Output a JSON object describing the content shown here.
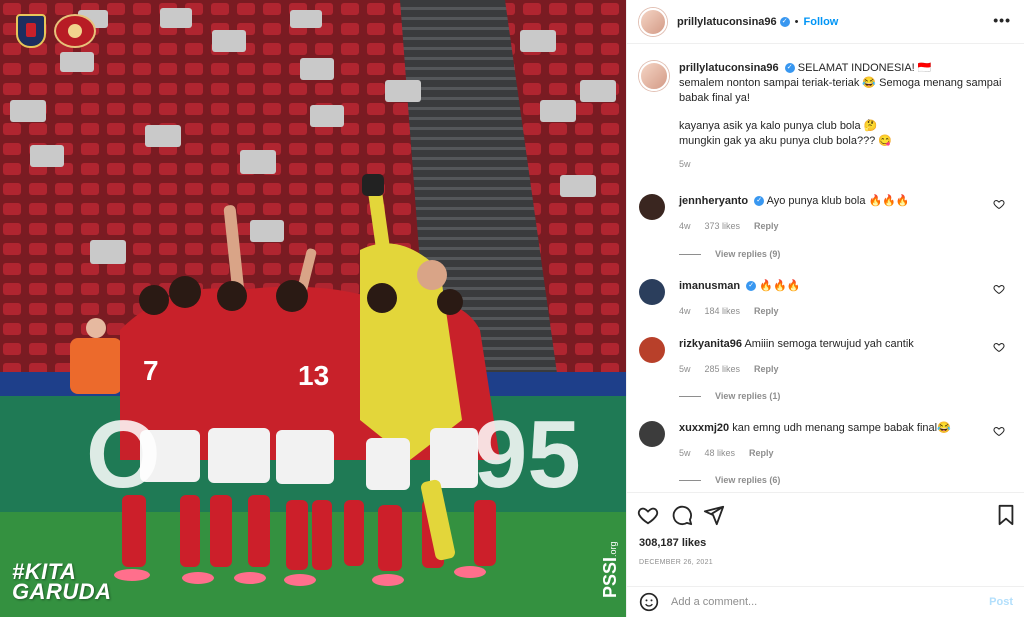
{
  "photo": {
    "hashtag_line1": "#KITA",
    "hashtag_line2": "GARUDA",
    "watermark": "PSSI",
    "watermark_suffix": ".org",
    "board_left": "O",
    "board_right": "95"
  },
  "header": {
    "username": "prillylatuconsina96",
    "separator": "•",
    "follow_label": "Follow",
    "more_label": "•••"
  },
  "caption": {
    "username": "prillylatuconsina96",
    "line1": "SELAMAT INDONESIA! 🇮🇩",
    "line2": "semalem nonton sampai teriak-teriak 😂 Semoga menang sampai babak final ya!",
    "line3": "kayanya asik ya kalo punya club bola 🤔",
    "line4": "mungkin gak ya aku punya club bola??? 😋",
    "time": "5w"
  },
  "comments": [
    {
      "username": "jennheryanto",
      "verified": true,
      "text": "Ayo punya klub bola 🔥🔥🔥",
      "time": "4w",
      "likes": "373 likes",
      "reply": "Reply",
      "view_replies": "View replies (9)",
      "avatar_color": "#3a2620"
    },
    {
      "username": "imanusman",
      "verified": true,
      "text": "🔥🔥🔥",
      "time": "4w",
      "likes": "184 likes",
      "reply": "Reply",
      "view_replies": "",
      "avatar_color": "#2b3e5c"
    },
    {
      "username": "rizkyanita96",
      "verified": false,
      "text": "Amiiin semoga terwujud yah cantik",
      "time": "5w",
      "likes": "285 likes",
      "reply": "Reply",
      "view_replies": "View replies (1)",
      "avatar_color": "#b8402a"
    },
    {
      "username": "xuxxmj20",
      "verified": false,
      "text": "kan emng udh menang sampe babak final😂",
      "time": "5w",
      "likes": "48 likes",
      "reply": "Reply",
      "view_replies": "View replies (6)",
      "avatar_color": "#3c3c3c"
    }
  ],
  "stats": {
    "likes": "308,187 likes",
    "date": "DECEMBER 26, 2021"
  },
  "add_comment": {
    "placeholder": "Add a comment...",
    "post_label": "Post"
  },
  "colors": {
    "accent": "#0095f6",
    "verified": "#3897f0",
    "muted": "#8e8e8e",
    "post_disabled": "#b2dffc"
  },
  "icons": [
    "verified-badge-icon",
    "more-options-icon",
    "heart-icon",
    "comment-icon",
    "share-icon",
    "bookmark-icon",
    "emoji-icon"
  ]
}
